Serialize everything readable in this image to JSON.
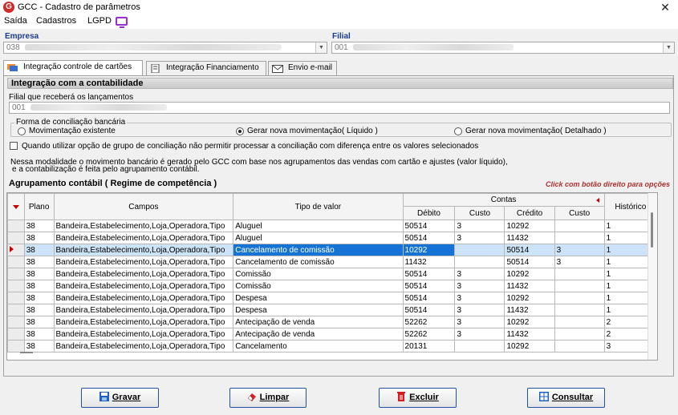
{
  "window": {
    "title": "GCC - Cadastro de parâmetros"
  },
  "menu": [
    "Saída",
    "Cadastros",
    "LGPD"
  ],
  "empresa": {
    "label": "Empresa",
    "value": "038"
  },
  "filial": {
    "label": "Filial",
    "value": "001"
  },
  "tabs": [
    {
      "label": "Integração controle de cartões"
    },
    {
      "label": "Integração Financiamento"
    },
    {
      "label": "Envio e-mail"
    }
  ],
  "section": {
    "title": "Integração com a contabilidade",
    "filial_label": "Filial que receberá os lançamentos",
    "filial_value": "001"
  },
  "conciliacao": {
    "legend": "Forma de conciliação bancária",
    "options": [
      "Movimentação existente",
      "Gerar nova movimentação( Líquido )",
      "Gerar nova movimentação( Detalhado )"
    ],
    "selected": 1
  },
  "checkbox_label": "Quando utilizar opção de grupo de conciliação não permitir processar a conciliação com diferença entre os valores selecionados",
  "info_lines": [
    "Nessa modalidade o movimento bancário é gerado pelo GCC com base nos agrupamentos das vendas com cartão e ajustes (valor líquido),",
    "e a contabilização é feita pelo agrupamento contábil."
  ],
  "grid": {
    "title": "Agrupamento contábil ( Regime de competência )",
    "hint": "Click com botão direito para opções",
    "headers": {
      "plano": "Plano",
      "campos": "Campos",
      "tipo": "Tipo de valor",
      "contas": "Contas",
      "debito": "Débito",
      "custo": "Custo",
      "credito": "Crédito",
      "custo2": "Custo",
      "historico": "Histórico"
    },
    "rows": [
      [
        "38",
        "Bandeira,Estabelecimento,Loja,Operadora,Tipo",
        "Aluguel",
        "50514",
        "3",
        "10292",
        "",
        "1"
      ],
      [
        "38",
        "Bandeira,Estabelecimento,Loja,Operadora,Tipo",
        "Aluguel",
        "50514",
        "3",
        "11432",
        "",
        "1"
      ],
      [
        "38",
        "Bandeira,Estabelecimento,Loja,Operadora,Tipo",
        "Cancelamento de comissão",
        "10292",
        "",
        "50514",
        "3",
        "1"
      ],
      [
        "38",
        "Bandeira,Estabelecimento,Loja,Operadora,Tipo",
        "Cancelamento de comissão",
        "11432",
        "",
        "50514",
        "3",
        "1"
      ],
      [
        "38",
        "Bandeira,Estabelecimento,Loja,Operadora,Tipo",
        "Comissão",
        "50514",
        "3",
        "10292",
        "",
        "1"
      ],
      [
        "38",
        "Bandeira,Estabelecimento,Loja,Operadora,Tipo",
        "Comissão",
        "50514",
        "3",
        "11432",
        "",
        "1"
      ],
      [
        "38",
        "Bandeira,Estabelecimento,Loja,Operadora,Tipo",
        "Despesa",
        "50514",
        "3",
        "10292",
        "",
        "1"
      ],
      [
        "38",
        "Bandeira,Estabelecimento,Loja,Operadora,Tipo",
        "Despesa",
        "50514",
        "3",
        "11432",
        "",
        "1"
      ],
      [
        "38",
        "Bandeira,Estabelecimento,Loja,Operadora,Tipo",
        "Antecipação de venda",
        "52262",
        "3",
        "10292",
        "",
        "2"
      ],
      [
        "38",
        "Bandeira,Estabelecimento,Loja,Operadora,Tipo",
        "Antecipação de venda",
        "52262",
        "3",
        "11432",
        "",
        "2"
      ],
      [
        "38",
        "Bandeira,Estabelecimento,Loja,Operadora,Tipo",
        "Cancelamento",
        "20131",
        "",
        "10292",
        "",
        "3"
      ]
    ],
    "selected_row": 2
  },
  "buttons": {
    "gravar": "Gravar",
    "limpar": "Limpar",
    "excluir": "Excluir",
    "consultar": "Consultar"
  },
  "colors": {
    "accent": "#1a3b8c",
    "selection": "#1573d6",
    "hint": "#b03030",
    "marker": "#c80000"
  }
}
